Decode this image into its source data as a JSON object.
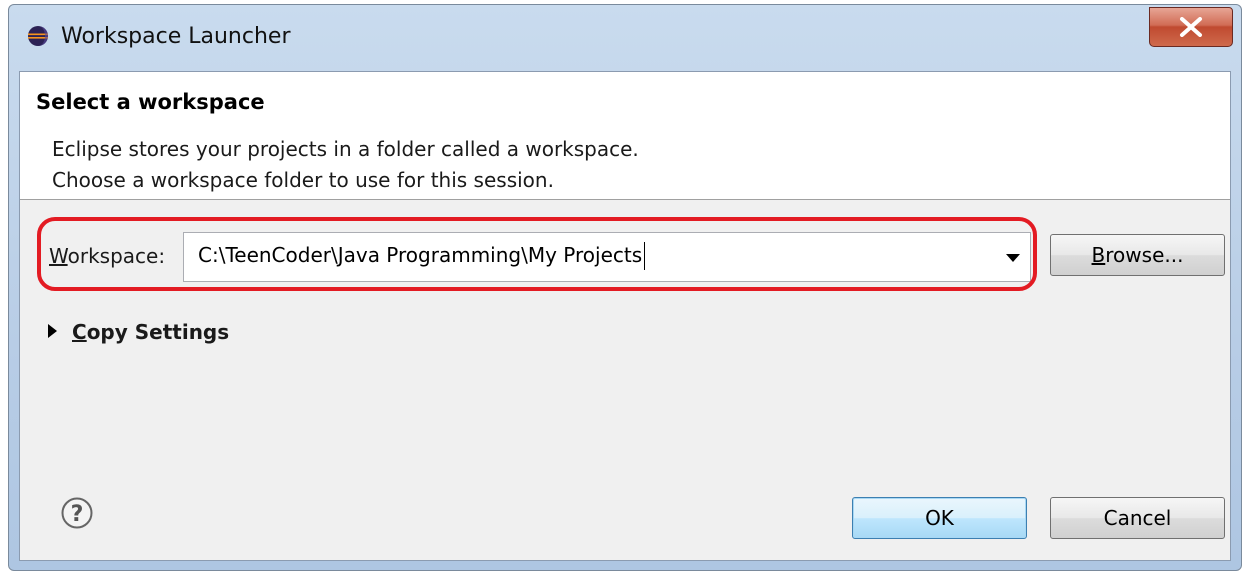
{
  "window": {
    "title": "Workspace Launcher",
    "icon": "eclipse-icon",
    "close_icon": "close-icon"
  },
  "banner": {
    "title": "Select a workspace",
    "line1": "Eclipse stores your projects in a folder called a workspace.",
    "line2": "Choose a workspace folder to use for this session."
  },
  "workspace": {
    "label_mnemonic": "W",
    "label_rest": "orkspace:",
    "value": "C:\\TeenCoder\\Java Programming\\My Projects",
    "highlight_color": "#e31b23"
  },
  "buttons": {
    "browse_mnemonic": "B",
    "browse_rest": "rowse...",
    "ok": "OK",
    "cancel": "Cancel"
  },
  "copy_settings": {
    "mnemonic": "C",
    "rest": "opy Settings",
    "expanded": false
  },
  "help": {
    "icon": "help-icon"
  }
}
